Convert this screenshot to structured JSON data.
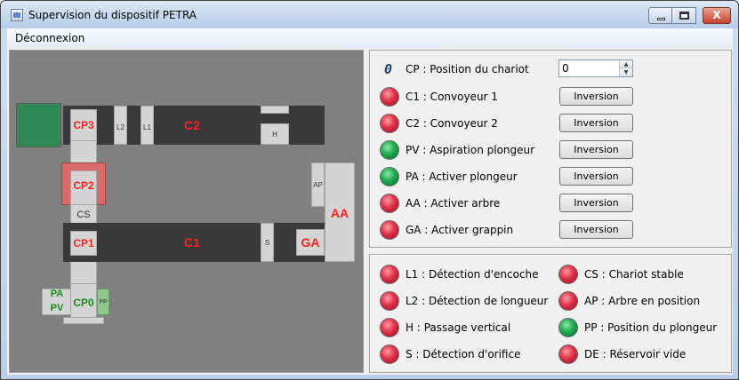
{
  "window": {
    "title": "Supervision du dispositif PETRA",
    "close_glyph": "X"
  },
  "menu": {
    "items": [
      "Déconnexion"
    ]
  },
  "schematic": {
    "labels": {
      "CP3": "CP3",
      "CP2": "CP2",
      "CS": "CS",
      "CP1": "CP1",
      "CP0": "CP0",
      "PA": "PA",
      "PV": "PV",
      "PP": "PP",
      "C1": "C1",
      "C2": "C2",
      "AA": "AA",
      "AP": "AP",
      "GA": "GA",
      "S": "S",
      "H": "H",
      "L1": "L1",
      "L2": "L2"
    },
    "colors": {
      "background": "#808080",
      "conveyor": "#3a3a3a",
      "module": "#d4d4d4",
      "reservoir_green": "#2f8a56",
      "cp2_red": "#d86a6a",
      "pp_green": "#8ec88a",
      "active_red_text": "#ff2020",
      "active_green_text": "#1c8a1c"
    }
  },
  "actuators": {
    "position": {
      "digit": "0",
      "label": "CP : Position du chariot",
      "spin_value": "0"
    },
    "rows": [
      {
        "led": "red",
        "label": "C1 : Convoyeur 1",
        "button": "Inversion"
      },
      {
        "led": "red",
        "label": "C2 : Convoyeur 2",
        "button": "Inversion"
      },
      {
        "led": "green",
        "label": "PV : Aspiration plongeur",
        "button": "Inversion"
      },
      {
        "led": "green",
        "label": "PA : Activer plongeur",
        "button": "Inversion"
      },
      {
        "led": "red",
        "label": "AA : Activer arbre",
        "button": "Inversion"
      },
      {
        "led": "red",
        "label": "GA : Activer grappin",
        "button": "Inversion"
      }
    ]
  },
  "sensors": {
    "left": [
      {
        "led": "red",
        "label": "L1 : Détection d'encoche"
      },
      {
        "led": "red",
        "label": "L2 : Détection de longueur"
      },
      {
        "led": "red",
        "label": "H : Passage vertical"
      },
      {
        "led": "red",
        "label": "S : Détection d'orifice"
      }
    ],
    "right": [
      {
        "led": "red",
        "label": "CS : Chariot stable"
      },
      {
        "led": "red",
        "label": "AP : Arbre en position"
      },
      {
        "led": "green",
        "label": "PP : Position du plongeur"
      },
      {
        "led": "red",
        "label": "DE : Réservoir vide"
      }
    ]
  }
}
